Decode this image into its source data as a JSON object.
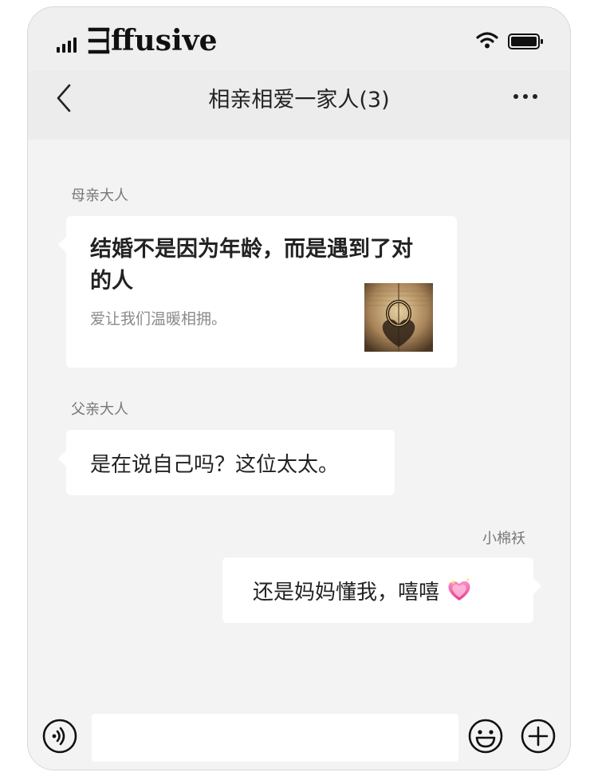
{
  "status_bar": {
    "carrier": "ffusive",
    "wifi_icon": "wifi-icon",
    "battery_icon": "battery-icon",
    "signal_icon": "signal-icon"
  },
  "nav": {
    "back_icon": "chevron-left-icon",
    "title": "相亲相爱一家人(3)",
    "more_icon": "more-dots-icon"
  },
  "messages": [
    {
      "sender": "母亲大人",
      "type": "link_card",
      "title": "结婚不是因为年龄，而是遇到了对的人",
      "description": "爱让我们温暖相拥。",
      "thumbnail_icon": "ring-heart-shadow-image"
    },
    {
      "sender": "父亲大人",
      "type": "text",
      "text": "是在说自己吗？这位太太。"
    },
    {
      "sender": "小棉袄",
      "type": "text",
      "text": "还是妈妈懂我，嘻嘻",
      "emoji_icon": "sparkling-heart-icon"
    }
  ],
  "input_bar": {
    "voice_icon": "voice-icon",
    "input_value": "",
    "emoji_icon": "smiley-icon",
    "plus_icon": "plus-icon"
  },
  "colors": {
    "background": "#efefef",
    "bubble": "#ffffff",
    "text": "#222222",
    "sender": "#777777"
  }
}
